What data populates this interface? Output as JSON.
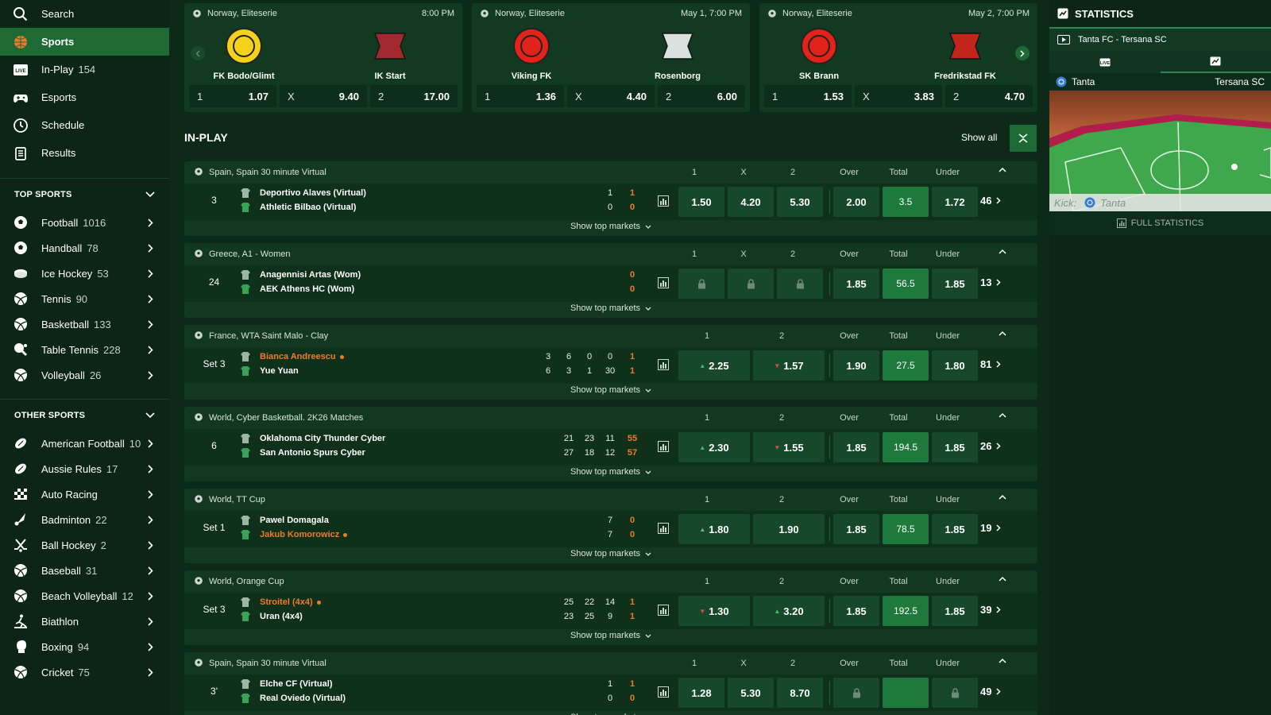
{
  "sidebar": {
    "nav": [
      {
        "label": "Search",
        "icon": "search-icon",
        "count": ""
      },
      {
        "label": "Sports",
        "icon": "sports-ball-icon",
        "count": "",
        "active": true
      },
      {
        "label": "In-Play",
        "icon": "live-icon",
        "count": "154"
      },
      {
        "label": "Esports",
        "icon": "gamepad-icon",
        "count": ""
      },
      {
        "label": "Schedule",
        "icon": "clock-icon",
        "count": ""
      },
      {
        "label": "Results",
        "icon": "clipboard-icon",
        "count": ""
      }
    ],
    "top_sports_title": "TOP SPORTS",
    "top_sports": [
      {
        "label": "Football",
        "count": "1016",
        "icon": "football-icon"
      },
      {
        "label": "Handball",
        "count": "78",
        "icon": "handball-icon"
      },
      {
        "label": "Ice Hockey",
        "count": "53",
        "icon": "ice-hockey-icon"
      },
      {
        "label": "Tennis",
        "count": "90",
        "icon": "tennis-icon"
      },
      {
        "label": "Basketball",
        "count": "133",
        "icon": "basketball-icon"
      },
      {
        "label": "Table Tennis",
        "count": "228",
        "icon": "table-tennis-icon"
      },
      {
        "label": "Volleyball",
        "count": "26",
        "icon": "volleyball-icon"
      }
    ],
    "other_sports_title": "OTHER SPORTS",
    "other_sports": [
      {
        "label": "American Football",
        "count": "10",
        "icon": "american-football-icon"
      },
      {
        "label": "Aussie Rules",
        "count": "17",
        "icon": "aussie-rules-icon"
      },
      {
        "label": "Auto Racing",
        "count": "",
        "icon": "checkered-flag-icon"
      },
      {
        "label": "Badminton",
        "count": "22",
        "icon": "shuttlecock-icon"
      },
      {
        "label": "Ball Hockey",
        "count": "2",
        "icon": "ball-hockey-icon"
      },
      {
        "label": "Baseball",
        "count": "31",
        "icon": "baseball-icon"
      },
      {
        "label": "Beach Volleyball",
        "count": "12",
        "icon": "beach-volleyball-icon"
      },
      {
        "label": "Biathlon",
        "count": "",
        "icon": "biathlon-icon"
      },
      {
        "label": "Boxing",
        "count": "94",
        "icon": "boxing-glove-icon"
      },
      {
        "label": "Cricket",
        "count": "75",
        "icon": "cricket-icon"
      }
    ]
  },
  "featured": [
    {
      "league": "Norway, Eliteserie",
      "time": "8:00 PM",
      "home": "FK Bodo/Glimt",
      "away": "IK Start",
      "home_color": "#f5d21a",
      "away_color": "#b8272e",
      "odds": [
        {
          "label": "1",
          "value": "1.07"
        },
        {
          "label": "X",
          "value": "9.40"
        },
        {
          "label": "2",
          "value": "17.00"
        }
      ]
    },
    {
      "league": "Norway, Eliteserie",
      "time": "May 1, 7:00 PM",
      "home": "Viking FK",
      "away": "Rosenborg",
      "home_color": "#e2231a",
      "away_color": "#ffffff",
      "odds": [
        {
          "label": "1",
          "value": "1.36"
        },
        {
          "label": "X",
          "value": "4.40"
        },
        {
          "label": "2",
          "value": "6.00"
        }
      ]
    },
    {
      "league": "Norway, Eliteserie",
      "time": "May 2, 7:00 PM",
      "home": "SK Brann",
      "away": "Fredrikstad FK",
      "home_color": "#e2231a",
      "away_color": "#e2231a",
      "odds": [
        {
          "label": "1",
          "value": "1.53"
        },
        {
          "label": "X",
          "value": "3.83"
        },
        {
          "label": "2",
          "value": "4.70"
        }
      ]
    }
  ],
  "inplay": {
    "title": "IN-PLAY",
    "show_all": "Show all",
    "show_top_markets": "Show top markets"
  },
  "events": [
    {
      "league": "Spain, Spain 30 minute Virtual",
      "three_way": true,
      "time": "3",
      "home": "Deportivo Alaves (Virtual)",
      "away": "Athletic Bilbao (Virtual)",
      "serve": "",
      "home_scores": [
        "1"
      ],
      "away_scores": [
        "0"
      ],
      "home_total": "1",
      "away_total": "0",
      "odds": [
        "1.50",
        "4.20",
        "5.30"
      ],
      "moves": [
        "",
        "",
        ""
      ],
      "locked": false,
      "over": "2.00",
      "total": "3.5",
      "under": "1.72",
      "ou_locked": false,
      "more": "46"
    },
    {
      "league": "Greece, A1 - Women",
      "three_way": true,
      "time": "24",
      "home": "Anagennisi Artas (Wom)",
      "away": "AEK Athens HC (Wom)",
      "serve": "",
      "home_scores": [],
      "away_scores": [],
      "home_total": "0",
      "away_total": "0",
      "odds": [
        "",
        "",
        ""
      ],
      "moves": [
        "",
        "",
        ""
      ],
      "locked": true,
      "over": "1.85",
      "total": "56.5",
      "under": "1.85",
      "ou_locked": false,
      "more": "13"
    },
    {
      "league": "France, WTA Saint Malo - Clay",
      "three_way": false,
      "time": "Set 3",
      "home": "Bianca Andreescu",
      "away": "Yue Yuan",
      "serve": "home",
      "home_scores": [
        "3",
        "6",
        "0",
        "0"
      ],
      "away_scores": [
        "6",
        "3",
        "1",
        "30"
      ],
      "home_total": "1",
      "away_total": "1",
      "odds": [
        "2.25",
        "1.57"
      ],
      "moves": [
        "up",
        "down"
      ],
      "locked": false,
      "over": "1.90",
      "total": "27.5",
      "under": "1.80",
      "ou_locked": false,
      "more": "81"
    },
    {
      "league": "World, Cyber Basketball. 2K26 Matches",
      "three_way": false,
      "time": "6",
      "home": "Oklahoma City Thunder Cyber",
      "away": "San Antonio Spurs Cyber",
      "serve": "",
      "home_scores": [
        "21",
        "23",
        "11"
      ],
      "away_scores": [
        "27",
        "18",
        "12"
      ],
      "home_total": "55",
      "away_total": "57",
      "odds": [
        "2.30",
        "1.55"
      ],
      "moves": [
        "up",
        "down"
      ],
      "locked": false,
      "over": "1.85",
      "total": "194.5",
      "under": "1.85",
      "ou_locked": false,
      "more": "26"
    },
    {
      "league": "World, TT Cup",
      "three_way": false,
      "time": "Set 1",
      "home": "Pawel Domagala",
      "away": "Jakub Komorowicz",
      "serve": "away",
      "home_scores": [
        "7"
      ],
      "away_scores": [
        "7"
      ],
      "home_total": "0",
      "away_total": "0",
      "odds": [
        "1.80",
        "1.90"
      ],
      "moves": [
        "neutral",
        ""
      ],
      "locked": false,
      "over": "1.85",
      "total": "78.5",
      "under": "1.85",
      "ou_locked": false,
      "more": "19"
    },
    {
      "league": "World, Orange Cup",
      "three_way": false,
      "time": "Set 3",
      "home": "Stroitel (4x4)",
      "away": "Uran (4x4)",
      "serve": "home",
      "home_scores": [
        "25",
        "22",
        "14"
      ],
      "away_scores": [
        "23",
        "25",
        "9"
      ],
      "home_total": "1",
      "away_total": "1",
      "odds": [
        "1.30",
        "3.20"
      ],
      "moves": [
        "down",
        "up"
      ],
      "locked": false,
      "over": "1.85",
      "total": "192.5",
      "under": "1.85",
      "ou_locked": false,
      "more": "39"
    },
    {
      "league": "Spain, Spain 30 minute Virtual",
      "three_way": true,
      "time": "3'",
      "home": "Elche CF (Virtual)",
      "away": "Real Oviedo (Virtual)",
      "serve": "",
      "home_scores": [
        "1"
      ],
      "away_scores": [
        "0"
      ],
      "home_total": "1",
      "away_total": "0",
      "odds": [
        "1.28",
        "5.30",
        "8.70"
      ],
      "moves": [
        "",
        "",
        ""
      ],
      "locked": false,
      "over": "",
      "total": "",
      "under": "",
      "ou_locked": true,
      "more": "49"
    }
  ],
  "col_labels": {
    "one": "1",
    "x": "X",
    "two": "2",
    "over": "Over",
    "total": "Total",
    "under": "Under"
  },
  "stats": {
    "title": "STATISTICS",
    "match": "Tanta FC - Tersana SC",
    "home": "Tanta",
    "away": "Tersana SC",
    "kick_label": "Kick:",
    "kick_team": "Tanta",
    "full_stats": "FULL STATISTICS"
  },
  "colors": {
    "accent": "#1e6a35",
    "serve": "#f07a28",
    "total_cell": "#1e7a3c",
    "bg": "#0d2a19"
  }
}
